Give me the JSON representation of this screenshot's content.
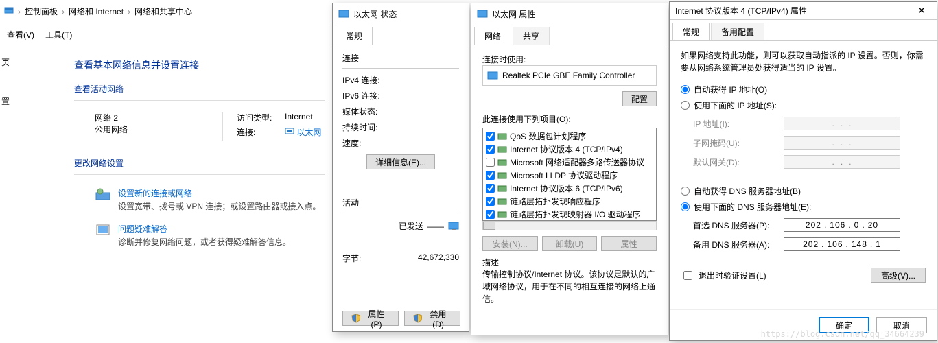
{
  "cp": {
    "bc": {
      "a": "控制面板",
      "b": "网络和 Internet",
      "c": "网络和共享中心"
    },
    "menu": {
      "view": "查看(V)",
      "tools": "工具(T)"
    },
    "side1": "页",
    "side2": "置",
    "heading": "查看基本网络信息并设置连接",
    "sub_active": "查看活动网络",
    "net_name": "网络  2",
    "net_type": "公用网络",
    "access_k": "访问类型:",
    "access_v": "Internet",
    "conn_k": "连接:",
    "conn_v": "以太网",
    "sub_change": "更改网络设置",
    "item1_link": "设置新的连接或网络",
    "item1_desc": "设置宽带、拨号或 VPN 连接；或设置路由器或接入点。",
    "item2_link": "问题疑难解答",
    "item2_desc": "诊断并修复网络问题，或者获得疑难解答信息。"
  },
  "eth": {
    "title": "以太网 状态",
    "tab": "常规",
    "grp_conn": "连接",
    "ipv4": "IPv4 连接:",
    "ipv6": "IPv6 连接:",
    "media": "媒体状态:",
    "dur": "持续时间:",
    "speed": "速度:",
    "btn_detail": "详细信息(E)...",
    "grp_act": "活动",
    "sent": "已发送",
    "bytes_k": "字节:",
    "bytes_v": "42,672,330",
    "btn_props": "属性(P)",
    "btn_disable": "禁用(D)"
  },
  "props": {
    "title": "以太网 属性",
    "tab1": "网络",
    "tab2": "共享",
    "conn_using": "连接时使用:",
    "adapter": "Realtek PCIe GBE Family Controller",
    "btn_cfg": "配置",
    "uses_label": "此连接使用下列项目(O):",
    "items": [
      {
        "chk": true,
        "label": "QoS 数据包计划程序"
      },
      {
        "chk": true,
        "label": "Internet 协议版本 4 (TCP/IPv4)"
      },
      {
        "chk": false,
        "label": "Microsoft 网络适配器多路传送器协议"
      },
      {
        "chk": true,
        "label": "Microsoft LLDP 协议驱动程序"
      },
      {
        "chk": true,
        "label": "Internet 协议版本 6 (TCP/IPv6)"
      },
      {
        "chk": true,
        "label": "链路层拓扑发现响应程序"
      },
      {
        "chk": true,
        "label": "链路层拓扑发现映射器 I/O 驱动程序"
      }
    ],
    "btn_install": "安装(N)...",
    "btn_uninstall": "卸载(U)",
    "btn_iprops": "属性",
    "desc_h": "描述",
    "desc": "传输控制协议/Internet 协议。该协议是默认的广域网络协议，用于在不同的相互连接的网络上通信。"
  },
  "ipv4": {
    "title": "Internet 协议版本 4 (TCP/IPv4) 属性",
    "tab1": "常规",
    "tab2": "备用配置",
    "info": "如果网络支持此功能，则可以获取自动指派的 IP 设置。否则，你需要从网络系统管理员处获得适当的 IP 设置。",
    "r_auto_ip": "自动获得 IP 地址(O)",
    "r_manual_ip": "使用下面的 IP 地址(S):",
    "f_ip": "IP 地址(I):",
    "f_mask": "子网掩码(U):",
    "f_gw": "默认网关(D):",
    "r_auto_dns": "自动获得 DNS 服务器地址(B)",
    "r_manual_dns": "使用下面的 DNS 服务器地址(E):",
    "f_dns1": "首选 DNS 服务器(P):",
    "f_dns2": "备用 DNS 服务器(A):",
    "dns1": [
      "202",
      "106",
      "0",
      "20"
    ],
    "dns2": [
      "202",
      "106",
      "148",
      "1"
    ],
    "chk_validate": "退出时验证设置(L)",
    "btn_adv": "高级(V)...",
    "btn_ok": "确定",
    "btn_cancel": "取消"
  },
  "watermark": "https://blog.csdn.net/qq_34664239"
}
